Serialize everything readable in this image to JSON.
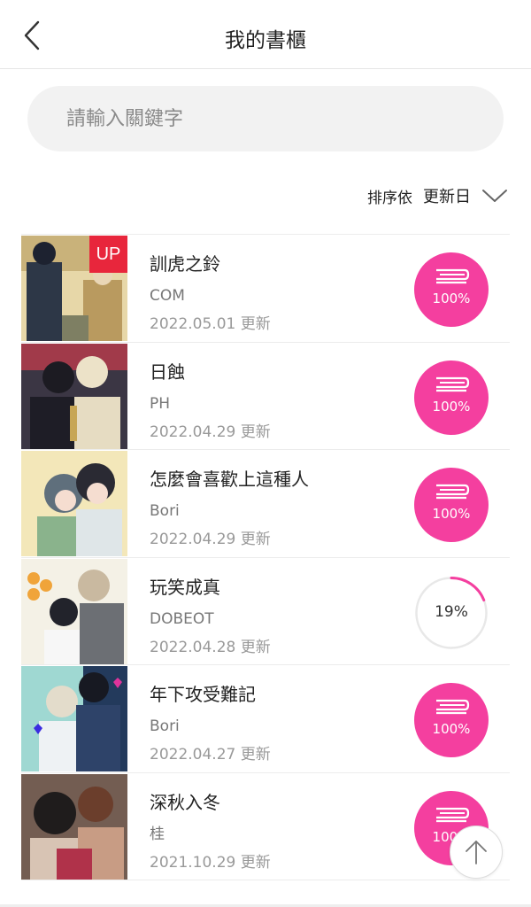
{
  "header": {
    "title": "我的書櫃",
    "back_icon": "chevron-left-icon"
  },
  "search": {
    "placeholder": "請輸入關鍵字",
    "value": ""
  },
  "sort": {
    "label": "排序依",
    "value": "更新日",
    "icon": "chevron-down-icon"
  },
  "colors": {
    "accent": "#f43f9f",
    "up_badge": "#e8263c",
    "ring_track": "#e8e8e8"
  },
  "books": [
    {
      "title": "訓虎之鈴",
      "author": "COM",
      "date": "2022.05.01 更新",
      "badge": "UP",
      "progress": 100,
      "progress_label": "100%"
    },
    {
      "title": "日蝕",
      "author": "PH",
      "date": "2022.04.29 更新",
      "badge": "",
      "progress": 100,
      "progress_label": "100%"
    },
    {
      "title": "怎麼會喜歡上這種人",
      "author": "Bori",
      "date": "2022.04.29 更新",
      "badge": "",
      "progress": 100,
      "progress_label": "100%"
    },
    {
      "title": "玩笑成真",
      "author": "DOBEOT",
      "date": "2022.04.28 更新",
      "badge": "",
      "progress": 19,
      "progress_label": "19%"
    },
    {
      "title": "年下攻受難記",
      "author": "Bori",
      "date": "2022.04.27 更新",
      "badge": "",
      "progress": 100,
      "progress_label": "100%"
    },
    {
      "title": "深秋入冬",
      "author": "桂",
      "date": "2021.10.29 更新",
      "badge": "",
      "progress": 100,
      "progress_label": "100%"
    }
  ],
  "scroll_top": {
    "icon": "arrow-up-icon"
  }
}
